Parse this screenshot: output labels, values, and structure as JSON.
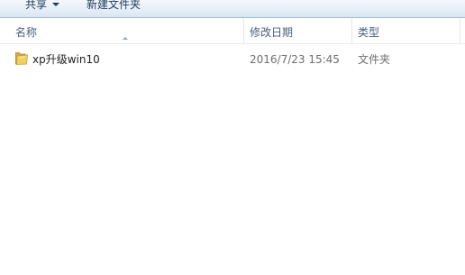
{
  "toolbar": {
    "share_label": "共享",
    "new_folder_label": "新建文件夹"
  },
  "columns": {
    "name": "名称",
    "date": "修改日期",
    "type": "类型"
  },
  "files": [
    {
      "name": "xp升级win10",
      "date": "2016/7/23 15:45",
      "type": "文件夹",
      "icon": "folder-icon"
    }
  ],
  "colors": {
    "toolbar_text": "#1e395b",
    "header_text": "#4c607a",
    "folder_yellow": "#e8c050"
  }
}
